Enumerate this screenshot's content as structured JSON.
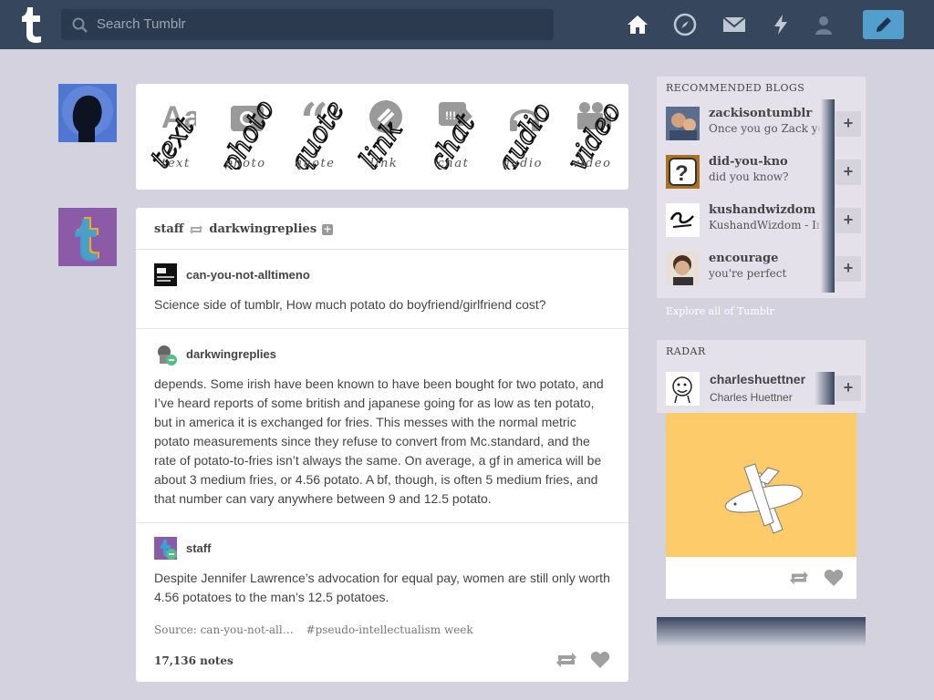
{
  "header": {
    "search_placeholder": "Search Tumblr",
    "nav": [
      "home-icon",
      "explore-icon",
      "inbox-icon",
      "activity-icon",
      "account-icon"
    ],
    "compose_icon": "pencil-icon",
    "colors": {
      "bar": "#36465d",
      "compose": "#529ecc"
    }
  },
  "post_types": [
    {
      "label": "text",
      "icon": "text-icon"
    },
    {
      "label": "photo",
      "icon": "camera-icon"
    },
    {
      "label": "quote",
      "icon": "quote-icon"
    },
    {
      "label": "link",
      "icon": "link-icon"
    },
    {
      "label": "chat",
      "icon": "chat-icon"
    },
    {
      "label": "audio",
      "icon": "headphones-icon"
    },
    {
      "label": "video",
      "icon": "video-icon"
    }
  ],
  "post": {
    "author": "staff",
    "reblogged_from": "darkwingreplies",
    "trail": [
      {
        "user": "can-you-not-alltimeno",
        "text": "Science side of tumblr, How much potato do boyfriend/girlfriend cost?"
      },
      {
        "user": "darkwingreplies",
        "text": "depends. Some irish have been known to have been bought for two potato, and I’ve heard reports of some british and japanese going for as low as ten potato, but in america it is exchanged for fries. This messes with the normal metric potato measurements since they refuse to convert from Mc.standard, and the rate of potato-to-fries isn’t always the same. On average, a gf in america will be about 3 medium fries, or 4.56 potato. A bf, though, is often 5 medium fries, and that number can vary anywhere between 9 and 12.5 potato."
      },
      {
        "user": "staff",
        "text": "Despite Jennifer Lawrence’s advocation for equal pay, women are still only worth 4.56 potatoes to the man’s 12.5 potatoes."
      }
    ],
    "source": "Source: can-you-not-all…",
    "tag": "#pseudo-intellectualism week",
    "notes": "17,136 notes"
  },
  "sidebar": {
    "recommended_title": "RECOMMENDED BLOGS",
    "blogs": [
      {
        "name": "zackisontumblr",
        "desc": "Once you go Zack you n"
      },
      {
        "name": "did-you-kno",
        "desc": "did you know?"
      },
      {
        "name": "kushandwizdom",
        "desc": "KushandWizdom - Insp"
      },
      {
        "name": "encourage",
        "desc": "you're perfect"
      }
    ],
    "explore": "Explore all of Tumblr",
    "radar_title": "RADAR",
    "radar": {
      "name": "charleshuettner",
      "desc": "Charles Huettner"
    },
    "follow_symbol": "+"
  }
}
